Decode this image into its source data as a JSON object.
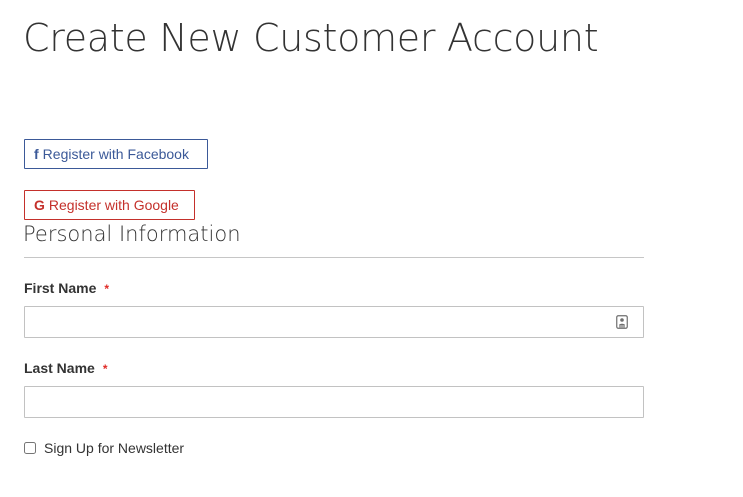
{
  "page": {
    "title": "Create New Customer Account"
  },
  "social": {
    "facebook": {
      "icon": "facebook-f-icon",
      "icon_glyph": "f",
      "label": "Register with Facebook",
      "color": "#3b5998"
    },
    "google": {
      "icon": "google-g-icon",
      "icon_glyph": "G",
      "label": "Register with Google",
      "color": "#c4302b"
    }
  },
  "personal_information": {
    "section_title": "Personal Information",
    "first_name": {
      "label": "First Name",
      "required_marker": "*",
      "value": "",
      "autofill_icon": "contact-card-icon"
    },
    "last_name": {
      "label": "Last Name",
      "required_marker": "*",
      "value": ""
    },
    "newsletter": {
      "label": "Sign Up for Newsletter",
      "checked": false
    }
  },
  "colors": {
    "required": "#e02b27",
    "border": "#c2c2c2",
    "text": "#333333"
  }
}
